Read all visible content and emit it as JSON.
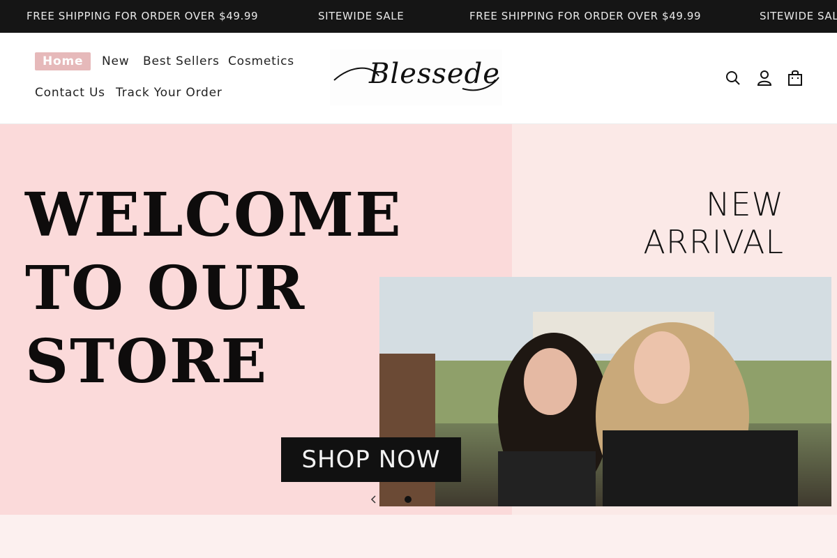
{
  "announcement": {
    "items": [
      "FREE SHIPPING FOR ORDER OVER $49.99",
      "SITEWIDE SALE",
      "FREE SHIPPING FOR ORDER OVER $49.99",
      "SITEWIDE SALE"
    ]
  },
  "nav": {
    "items": [
      {
        "label": "Home",
        "active": true
      },
      {
        "label": "New"
      },
      {
        "label": "Best Sellers"
      },
      {
        "label": "Cosmetics"
      },
      {
        "label": "Contact Us"
      },
      {
        "label": "Track Your Order"
      }
    ]
  },
  "logo": {
    "text": "Blessede"
  },
  "icons": {
    "search": "search-icon",
    "account": "account-icon",
    "cart": "cart-icon"
  },
  "hero": {
    "headline": [
      "WELCOME",
      "TO OUR",
      "STORE"
    ],
    "tagline": [
      "NEW",
      "ARRIVAL"
    ],
    "cta": "SHOP NOW"
  },
  "colors": {
    "announcement_bg": "#151515",
    "active_nav_bg": "#e6b9ba",
    "hero_left_bg": "#fbdada",
    "hero_right_bg": "#fbe9e7",
    "cta_bg": "#111111"
  }
}
